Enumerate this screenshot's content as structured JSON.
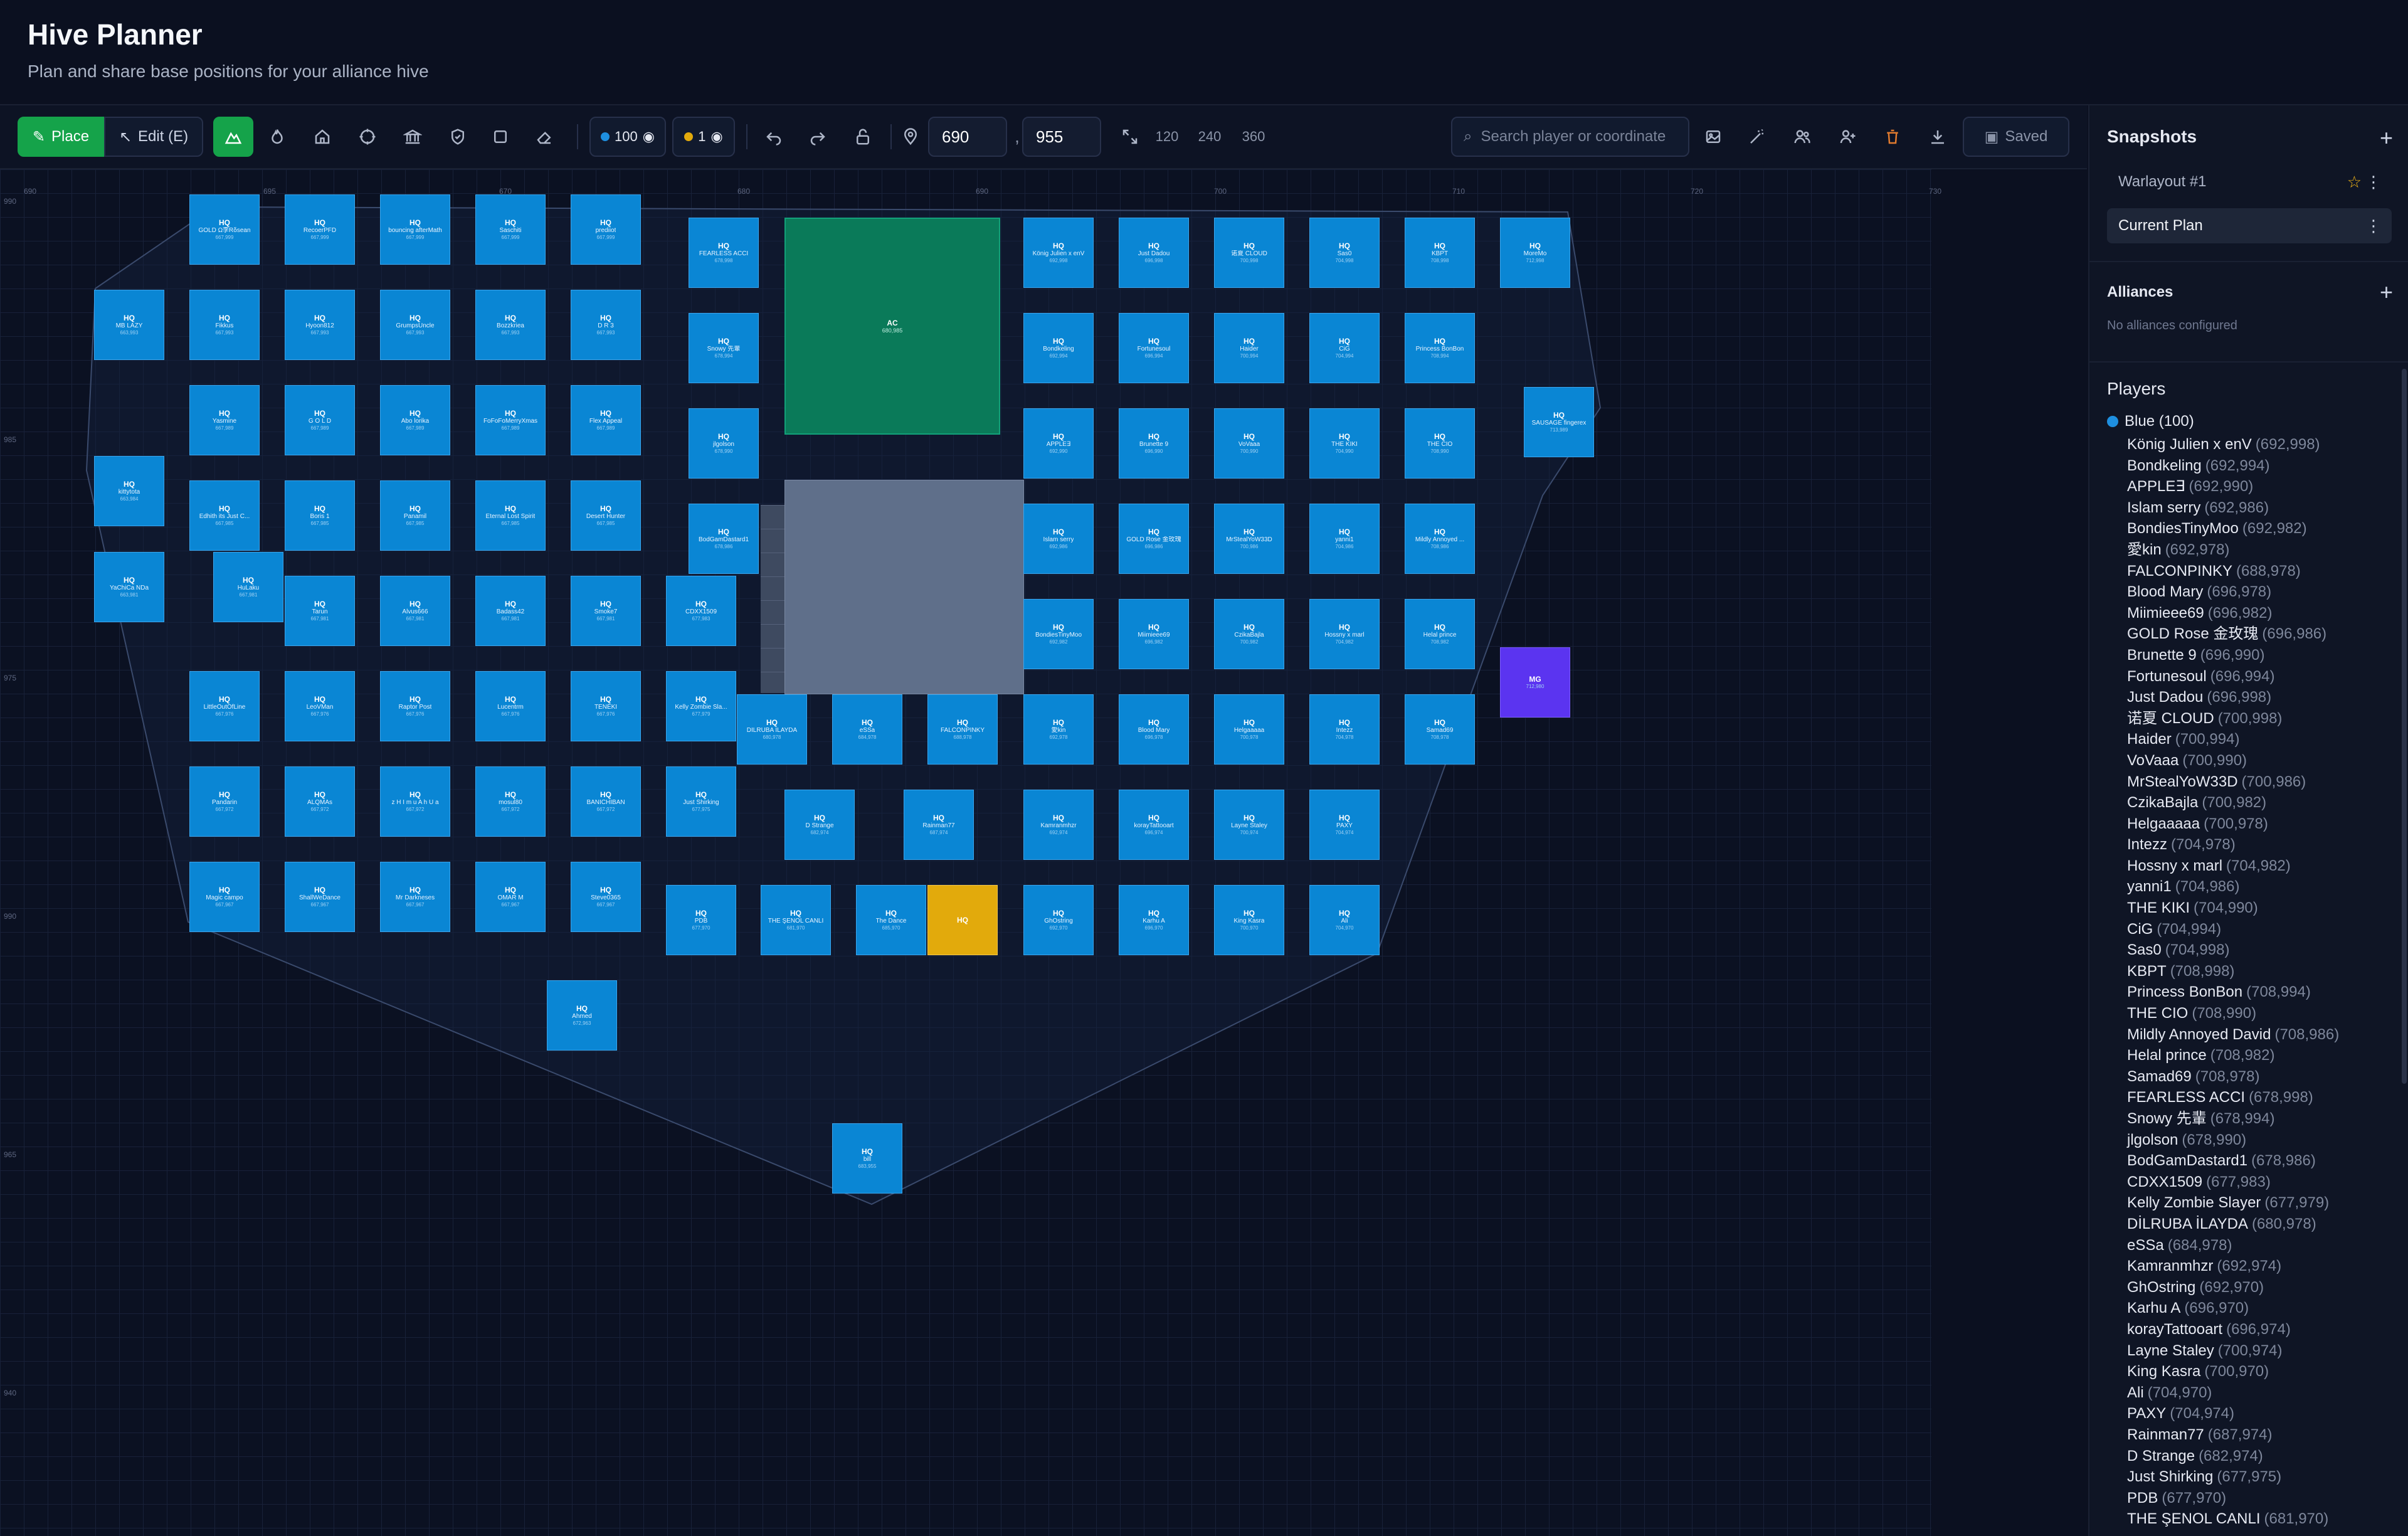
{
  "header": {
    "title": "Hive Planner",
    "subtitle": "Plan and share base positions for your alliance hive"
  },
  "toolbar": {
    "place_label": "Place",
    "edit_label": "Edit (E)",
    "blue_count": "100",
    "gold_count": "1",
    "x_value": "690",
    "y_value": "955",
    "zoom_levels": [
      "120",
      "240",
      "360"
    ],
    "search_placeholder": "Search player or coordinate",
    "saved_label": "Saved"
  },
  "colors": {
    "accent": "#15a34a",
    "tile_blue": "#0a86d4",
    "tile_gold": "#e2aa0c",
    "tile_purple": "#5b34f0",
    "ac_green": "#0a7a59"
  },
  "canvas": {
    "x_axis": [
      "690",
      "695",
      "670",
      "680",
      "690",
      "700",
      "710",
      "720",
      "730"
    ],
    "y_axis": [
      "990",
      "985",
      "975",
      "990",
      "965",
      "940"
    ],
    "ac": {
      "label": "AC",
      "coord": "680,985"
    },
    "tiles": [
      {
        "hq": "HQ",
        "name": "GOLD Ω李Rδsean",
        "coord": "667,999"
      },
      {
        "hq": "HQ",
        "name": "RecoerPFD",
        "coord": "667,999"
      },
      {
        "hq": "HQ",
        "name": "bouncing afterMath",
        "coord": "667,999"
      },
      {
        "hq": "HQ",
        "name": "Saschiti",
        "coord": "667,999"
      },
      {
        "hq": "HQ",
        "name": "prediiot",
        "coord": "667,999"
      },
      {
        "hq": "HQ",
        "name": "FEARLESS ACCI",
        "coord": "678,998"
      },
      {
        "hq": "HQ",
        "name": "König Julien x enV",
        "coord": "692,998"
      },
      {
        "hq": "HQ",
        "name": "Just Dadou",
        "coord": "696,998"
      },
      {
        "hq": "HQ",
        "name": "诺夏 CLOUD",
        "coord": "700,998"
      },
      {
        "hq": "HQ",
        "name": "Sas0",
        "coord": "704,998"
      },
      {
        "hq": "HQ",
        "name": "KBPT",
        "coord": "708,998"
      },
      {
        "hq": "HQ",
        "name": "MoreMo",
        "coord": "712,998"
      },
      {
        "hq": "HQ",
        "name": "MB LAZY",
        "coord": "663,993"
      },
      {
        "hq": "HQ",
        "name": "Fikkus",
        "coord": "667,993"
      },
      {
        "hq": "HQ",
        "name": "Hyoon812",
        "coord": "667,993"
      },
      {
        "hq": "HQ",
        "name": "GrumpsUncle",
        "coord": "667,993"
      },
      {
        "hq": "HQ",
        "name": "Bozzkriea",
        "coord": "667,993"
      },
      {
        "hq": "HQ",
        "name": "D R 3",
        "coord": "667,993"
      },
      {
        "hq": "HQ",
        "name": "Snowy 先輩",
        "coord": "678,994"
      },
      {
        "hq": "HQ",
        "name": "Bondkeling",
        "coord": "692,994"
      },
      {
        "hq": "HQ",
        "name": "Fortunesoul",
        "coord": "696,994"
      },
      {
        "hq": "HQ",
        "name": "Haider",
        "coord": "700,994"
      },
      {
        "hq": "HQ",
        "name": "CiG",
        "coord": "704,994"
      },
      {
        "hq": "HQ",
        "name": "Princess BonBon",
        "coord": "708,994"
      },
      {
        "hq": "HQ",
        "name": "Yasmine",
        "coord": "667,989"
      },
      {
        "hq": "HQ",
        "name": "G O L D",
        "coord": "667,989"
      },
      {
        "hq": "HQ",
        "name": "Abo lorika",
        "coord": "667,989"
      },
      {
        "hq": "HQ",
        "name": "FoFoFoMerryXmas",
        "coord": "667,989"
      },
      {
        "hq": "HQ",
        "name": "Flex Appeal",
        "coord": "667,989"
      },
      {
        "hq": "HQ",
        "name": "jlgolson",
        "coord": "678,990"
      },
      {
        "hq": "HQ",
        "name": "APPLE∃",
        "coord": "692,990"
      },
      {
        "hq": "HQ",
        "name": "Brunette 9",
        "coord": "696,990"
      },
      {
        "hq": "HQ",
        "name": "VoVaaa",
        "coord": "700,990"
      },
      {
        "hq": "HQ",
        "name": "THE KIKI",
        "coord": "704,990"
      },
      {
        "hq": "HQ",
        "name": "THE CIO",
        "coord": "708,990"
      },
      {
        "hq": "HQ",
        "name": "SAUSAGE fingerex",
        "coord": "713,989"
      },
      {
        "hq": "HQ",
        "name": "kittytota",
        "coord": "663,984"
      },
      {
        "hq": "HQ",
        "name": "Edhith its Just C...",
        "coord": "667,985"
      },
      {
        "hq": "HQ",
        "name": "Boris 1",
        "coord": "667,985"
      },
      {
        "hq": "HQ",
        "name": "Panamil",
        "coord": "667,985"
      },
      {
        "hq": "HQ",
        "name": "Eternal Lost Spirit",
        "coord": "667,985"
      },
      {
        "hq": "HQ",
        "name": "Desert Hunter",
        "coord": "667,985"
      },
      {
        "hq": "HQ",
        "name": "BodGamDastard1",
        "coord": "678,986"
      },
      {
        "hq": "HQ",
        "name": "Islam serry",
        "coord": "692,986"
      },
      {
        "hq": "HQ",
        "name": "GOLD Rose 金玫瑰",
        "coord": "696,986"
      },
      {
        "hq": "HQ",
        "name": "MrStealYoW33D",
        "coord": "700,986"
      },
      {
        "hq": "HQ",
        "name": "yanni1",
        "coord": "704,986"
      },
      {
        "hq": "HQ",
        "name": "Mildly Annoyed ...",
        "coord": "708,986"
      },
      {
        "hq": "HQ",
        "name": "YaChiCa NDa",
        "coord": "663,981"
      },
      {
        "hq": "HQ",
        "name": "HuLaku",
        "coord": "667,981"
      },
      {
        "hq": "HQ",
        "name": "Tarun",
        "coord": "667,981"
      },
      {
        "hq": "HQ",
        "name": "Alvus666",
        "coord": "667,981"
      },
      {
        "hq": "HQ",
        "name": "Badass42",
        "coord": "667,981"
      },
      {
        "hq": "HQ",
        "name": "Smoke7",
        "coord": "667,981"
      },
      {
        "hq": "HQ",
        "name": "CDXX1509",
        "coord": "677,983"
      },
      {
        "hq": "HQ",
        "name": "BondiesTinyMoo",
        "coord": "692,982"
      },
      {
        "hq": "HQ",
        "name": "Miimieee69",
        "coord": "696,982"
      },
      {
        "hq": "HQ",
        "name": "CzikaBajla",
        "coord": "700,982"
      },
      {
        "hq": "HQ",
        "name": "Hossny x marl",
        "coord": "704,982"
      },
      {
        "hq": "HQ",
        "name": "Helal prince",
        "coord": "708,982"
      },
      {
        "hq": "HQ",
        "name": "LittleOutOfLine",
        "coord": "667,976"
      },
      {
        "hq": "HQ",
        "name": "LeoVMan",
        "coord": "667,976"
      },
      {
        "hq": "HQ",
        "name": "Raptor Post",
        "coord": "667,976"
      },
      {
        "hq": "HQ",
        "name": "Lucentrm",
        "coord": "667,976"
      },
      {
        "hq": "HQ",
        "name": "TENEKI",
        "coord": "667,976"
      },
      {
        "hq": "HQ",
        "name": "Kelly Zombie Sla...",
        "coord": "677,979"
      },
      {
        "hq": "HQ",
        "name": "DİLRUBA İLAYDA",
        "coord": "680,978"
      },
      {
        "hq": "HQ",
        "name": "eSSa",
        "coord": "684,978"
      },
      {
        "hq": "HQ",
        "name": "FALCONPINKY",
        "coord": "688,978"
      },
      {
        "hq": "HQ",
        "name": "愛kin",
        "coord": "692,978"
      },
      {
        "hq": "HQ",
        "name": "Blood Mary",
        "coord": "696,978"
      },
      {
        "hq": "HQ",
        "name": "Helgaaaaa",
        "coord": "700,978"
      },
      {
        "hq": "HQ",
        "name": "Intezz",
        "coord": "704,978"
      },
      {
        "hq": "HQ",
        "name": "Samad69",
        "coord": "708,978"
      },
      {
        "hq": "HQ",
        "name": "Pandarin",
        "coord": "667,972"
      },
      {
        "hq": "HQ",
        "name": "ALQMAs",
        "coord": "667,972"
      },
      {
        "hq": "HQ",
        "name": "z H I m u A h U a",
        "coord": "667,972"
      },
      {
        "hq": "HQ",
        "name": "mosul80",
        "coord": "667,972"
      },
      {
        "hq": "HQ",
        "name": "BANICHIBAN",
        "coord": "667,972"
      },
      {
        "hq": "HQ",
        "name": "Just Shirking",
        "coord": "677,975"
      },
      {
        "hq": "HQ",
        "name": "D Strange",
        "coord": "682,974"
      },
      {
        "hq": "HQ",
        "name": "Rainman77",
        "coord": "687,974"
      },
      {
        "hq": "HQ",
        "name": "Kamranmhzr",
        "coord": "692,974"
      },
      {
        "hq": "HQ",
        "name": "korayTattooart",
        "coord": "696,974"
      },
      {
        "hq": "HQ",
        "name": "Layne Staley",
        "coord": "700,974"
      },
      {
        "hq": "HQ",
        "name": "PAXY",
        "coord": "704,974"
      },
      {
        "hq": "HQ",
        "name": "Magic campo",
        "coord": "667,967"
      },
      {
        "hq": "HQ",
        "name": "ShallWeDance",
        "coord": "667,967"
      },
      {
        "hq": "HQ",
        "name": "Mr Darkneses",
        "coord": "667,967"
      },
      {
        "hq": "HQ",
        "name": "OMAR M",
        "coord": "667,967"
      },
      {
        "hq": "HQ",
        "name": "Steve0365",
        "coord": "667,967"
      },
      {
        "hq": "HQ",
        "name": "PDB",
        "coord": "677,970"
      },
      {
        "hq": "HQ",
        "name": "THE ŞENOL CANLI",
        "coord": "681,970"
      },
      {
        "hq": "HQ",
        "name": "The Dance",
        "coord": "685,970"
      },
      {
        "hq": "HQ",
        "name": "",
        "coord": ""
      },
      {
        "hq": "HQ",
        "name": "GhOstring",
        "coord": "692,970"
      },
      {
        "hq": "HQ",
        "name": "Karhu A",
        "coord": "696,970"
      },
      {
        "hq": "HQ",
        "name": "King Kasra",
        "coord": "700,970"
      },
      {
        "hq": "HQ",
        "name": "Ali",
        "coord": "704,970"
      },
      {
        "hq": "HQ",
        "name": "Ahmed",
        "coord": "672,963"
      },
      {
        "hq": "HQ",
        "name": "bill",
        "coord": "683,955"
      },
      {
        "hq": "MG",
        "name": "",
        "coord": "712,980"
      }
    ]
  },
  "sidebar": {
    "snapshots_title": "Snapshots",
    "snapshots": [
      "Warlayout #1",
      "Current Plan"
    ],
    "alliances_title": "Alliances",
    "no_alliances": "No alliances configured",
    "players_title": "Players",
    "alliance_label": "Blue (100)",
    "players": [
      {
        "name": "König Julien x enV",
        "coord": "(692,998)"
      },
      {
        "name": "Bondkeling",
        "coord": "(692,994)"
      },
      {
        "name": "APPLE∃",
        "coord": "(692,990)"
      },
      {
        "name": "Islam serry",
        "coord": "(692,986)"
      },
      {
        "name": "BondiesTinyMoo",
        "coord": "(692,982)"
      },
      {
        "name": "愛kin",
        "coord": "(692,978)"
      },
      {
        "name": "FALCONPINKY",
        "coord": "(688,978)"
      },
      {
        "name": "Blood Mary",
        "coord": "(696,978)"
      },
      {
        "name": "Miimieee69",
        "coord": "(696,982)"
      },
      {
        "name": "GOLD Rose 金玫瑰",
        "coord": "(696,986)"
      },
      {
        "name": "Brunette 9",
        "coord": "(696,990)"
      },
      {
        "name": "Fortunesoul",
        "coord": "(696,994)"
      },
      {
        "name": "Just Dadou",
        "coord": "(696,998)"
      },
      {
        "name": "诺夏 CLOUD",
        "coord": "(700,998)"
      },
      {
        "name": "Haider",
        "coord": "(700,994)"
      },
      {
        "name": "VoVaaa",
        "coord": "(700,990)"
      },
      {
        "name": "MrStealYoW33D",
        "coord": "(700,986)"
      },
      {
        "name": "CzikaBajla",
        "coord": "(700,982)"
      },
      {
        "name": "Helgaaaaa",
        "coord": "(700,978)"
      },
      {
        "name": "Intezz",
        "coord": "(704,978)"
      },
      {
        "name": "Hossny x marl",
        "coord": "(704,982)"
      },
      {
        "name": "yanni1",
        "coord": "(704,986)"
      },
      {
        "name": "THE KIKI",
        "coord": "(704,990)"
      },
      {
        "name": "CiG",
        "coord": "(704,994)"
      },
      {
        "name": "Sas0",
        "coord": "(704,998)"
      },
      {
        "name": "KBPT",
        "coord": "(708,998)"
      },
      {
        "name": "Princess BonBon",
        "coord": "(708,994)"
      },
      {
        "name": "THE CIO",
        "coord": "(708,990)"
      },
      {
        "name": "Mildly Annoyed David",
        "coord": "(708,986)"
      },
      {
        "name": "Helal prince",
        "coord": "(708,982)"
      },
      {
        "name": "Samad69",
        "coord": "(708,978)"
      },
      {
        "name": "FEARLESS ACCI",
        "coord": "(678,998)"
      },
      {
        "name": "Snowy 先輩",
        "coord": "(678,994)"
      },
      {
        "name": "jlgolson",
        "coord": "(678,990)"
      },
      {
        "name": "BodGamDastard1",
        "coord": "(678,986)"
      },
      {
        "name": "CDXX1509",
        "coord": "(677,983)"
      },
      {
        "name": "Kelly Zombie Slayer",
        "coord": "(677,979)"
      },
      {
        "name": "DİLRUBA İLAYDA",
        "coord": "(680,978)"
      },
      {
        "name": "eSSa",
        "coord": "(684,978)"
      },
      {
        "name": "Kamranmhzr",
        "coord": "(692,974)"
      },
      {
        "name": "GhOstring",
        "coord": "(692,970)"
      },
      {
        "name": "Karhu A",
        "coord": "(696,970)"
      },
      {
        "name": "korayTattooart",
        "coord": "(696,974)"
      },
      {
        "name": "Layne Staley",
        "coord": "(700,974)"
      },
      {
        "name": "King Kasra",
        "coord": "(700,970)"
      },
      {
        "name": "Ali",
        "coord": "(704,970)"
      },
      {
        "name": "PAXY",
        "coord": "(704,974)"
      },
      {
        "name": "Rainman77",
        "coord": "(687,974)"
      },
      {
        "name": "D Strange",
        "coord": "(682,974)"
      },
      {
        "name": "Just Shirking",
        "coord": "(677,975)"
      },
      {
        "name": "PDB",
        "coord": "(677,970)"
      },
      {
        "name": "THE ŞENOL CANLI",
        "coord": "(681,970)"
      }
    ]
  }
}
